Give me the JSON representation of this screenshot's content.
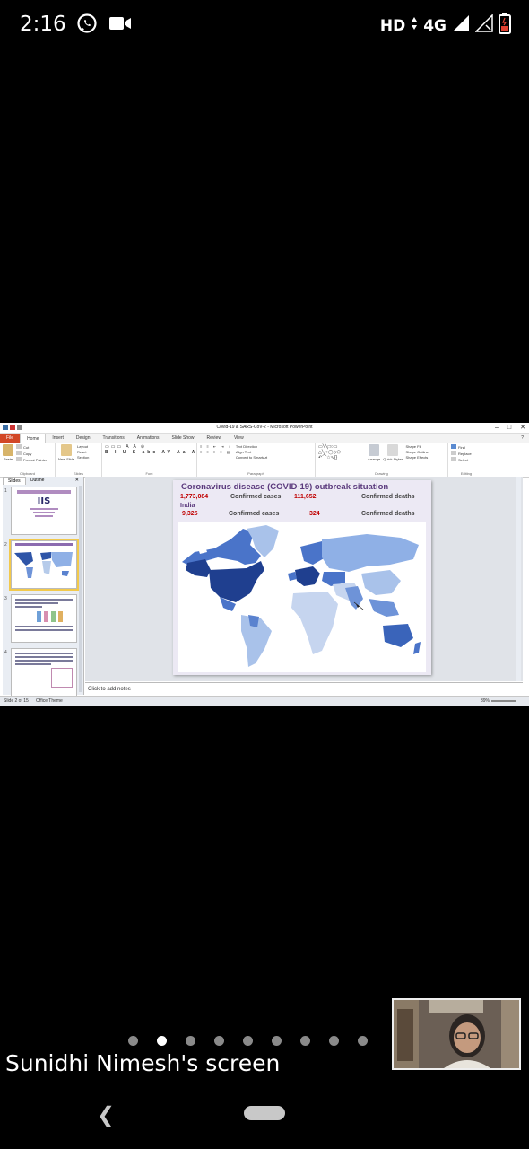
{
  "status_bar": {
    "time": "2:16",
    "network": "HD",
    "network_type": "4G"
  },
  "powerpoint": {
    "window_title": "Covid-19 & SARS-CoV-2 - Microsoft PowerPoint",
    "tabs": [
      "File",
      "Home",
      "Insert",
      "Design",
      "Transitions",
      "Animations",
      "Slide Show",
      "Review",
      "View"
    ],
    "active_tab": "Home",
    "ribbon": {
      "clipboard": {
        "paste": "Paste",
        "cut": "Cut",
        "copy": "Copy",
        "format_painter": "Format Painter",
        "label": "Clipboard"
      },
      "slides": {
        "new_slide": "New Slide",
        "layout": "Layout",
        "reset": "Reset",
        "section": "Section",
        "label": "Slides"
      },
      "font": {
        "label": "Font"
      },
      "paragraph": {
        "text_direction": "Text Direction",
        "align_text": "Align Text",
        "convert_smartart": "Convert to SmartArt",
        "label": "Paragraph"
      },
      "drawing": {
        "arrange": "Arrange",
        "quick_styles": "Quick Styles",
        "shape_fill": "Shape Fill",
        "shape_outline": "Shape Outline",
        "shape_effects": "Shape Effects",
        "label": "Drawing"
      },
      "editing": {
        "find": "Find",
        "replace": "Replace",
        "select": "Select",
        "label": "Editing"
      }
    },
    "panel_tabs": [
      "Slides",
      "Outline"
    ],
    "thumbnails": [
      {
        "number": "1",
        "logo": "IIS"
      },
      {
        "number": "2"
      },
      {
        "number": "3"
      },
      {
        "number": "4"
      }
    ],
    "slide": {
      "title": "Coronavirus disease (COVID-19) outbreak situation",
      "global_cases": "1,773,084",
      "global_cases_label": "Confirmed cases",
      "global_deaths": "111,652",
      "global_deaths_label": "Confirmed deaths",
      "country": "India",
      "india_cases": "9,325",
      "india_cases_label": "Confirmed cases",
      "india_deaths": "324",
      "india_deaths_label": "Confirmed deaths"
    },
    "notes_placeholder": "Click to add notes",
    "status": {
      "slide_info": "Slide 2 of 15",
      "theme": "Office Theme",
      "zoom": "39%"
    }
  },
  "meeting": {
    "screen_owner": "Sunidhi Nimesh's screen",
    "page_dots": 9,
    "active_dot": 2
  },
  "colors": {
    "map_dark": "#1f3f8f",
    "map_mid": "#4a74c9",
    "map_light": "#a9c2ea",
    "title_purple": "#5b3a7d",
    "red_values": "#c00000"
  }
}
